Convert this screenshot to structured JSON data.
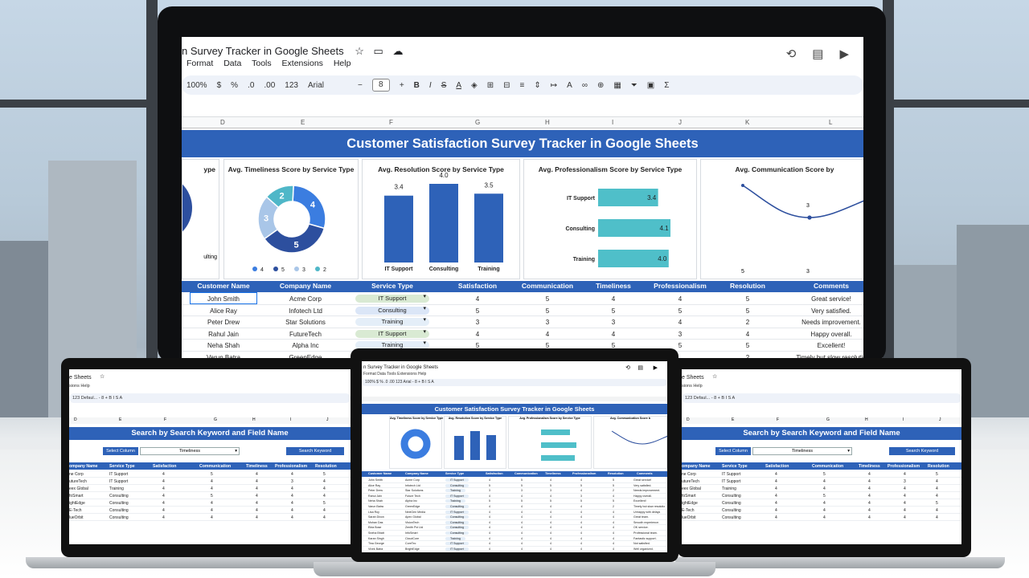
{
  "main": {
    "doc_title": "n Survey Tracker in Google Sheets",
    "menus": [
      "Format",
      "Data",
      "Tools",
      "Extensions",
      "Help"
    ],
    "toolbar": {
      "zoom": "100%",
      "currency": "$",
      "percent": "%",
      "dec_dec": ".0",
      "dec_inc": ".00",
      "num": "123",
      "font": "Arial",
      "font_size": "8"
    },
    "columns": [
      "D",
      "E",
      "F",
      "G",
      "H",
      "I",
      "J",
      "K",
      "L"
    ],
    "banner": "Customer Satisfaction Survey Tracker in Google Sheets",
    "charts": [
      {
        "title": "ype",
        "labels": [
          "ulting"
        ]
      },
      {
        "title": "Avg. Timeliness Score by Service Type",
        "type": "pie",
        "slices": [
          {
            "label": "4",
            "value": 4,
            "color": "#3b7de0"
          },
          {
            "label": "5",
            "value": 5,
            "color": "#2d4f9e"
          },
          {
            "label": "3",
            "value": 3,
            "color": "#a9c6e8"
          },
          {
            "label": "2",
            "value": 2,
            "color": "#4fb7c8"
          }
        ],
        "legend": [
          "4",
          "5",
          "3",
          "2"
        ]
      },
      {
        "title": "Avg. Resolution Score by Service Type",
        "type": "bar",
        "categories": [
          "IT Support",
          "Consulting",
          "Training"
        ],
        "values": [
          3.4,
          4.0,
          3.5
        ],
        "value_labels": [
          "3.4",
          "4.0",
          "3.5"
        ]
      },
      {
        "title": "Avg. Professionalism Score by Service Type",
        "type": "hbar",
        "categories": [
          "IT Support",
          "Consulting",
          "Training"
        ],
        "values": [
          3.4,
          4.1,
          4.0
        ],
        "value_labels": [
          "3.4",
          "4.1",
          "4.0"
        ]
      },
      {
        "title": "Avg. Communication Score by",
        "type": "line",
        "point_label": "3",
        "axis_labels": [
          "5",
          "3"
        ]
      }
    ],
    "table": {
      "headers": [
        "Customer Name",
        "Company Name",
        "Service Type",
        "Satisfaction",
        "Communication",
        "Timeliness",
        "Professionalism",
        "Resolution",
        "Comments"
      ],
      "rows": [
        {
          "name": "John Smith",
          "company": "Acme Corp",
          "service": "IT Support",
          "sat": "4",
          "comm": "5",
          "time": "4",
          "prof": "4",
          "res": "5",
          "comment": "Great service!"
        },
        {
          "name": "Alice Ray",
          "company": "Infotech Ltd",
          "service": "Consulting",
          "sat": "5",
          "comm": "5",
          "time": "5",
          "prof": "5",
          "res": "5",
          "comment": "Very satisfied."
        },
        {
          "name": "Peter Drew",
          "company": "Star Solutions",
          "service": "Training",
          "sat": "3",
          "comm": "3",
          "time": "3",
          "prof": "4",
          "res": "2",
          "comment": "Needs improvement."
        },
        {
          "name": "Rahul Jain",
          "company": "FutureTech",
          "service": "IT Support",
          "sat": "4",
          "comm": "4",
          "time": "4",
          "prof": "3",
          "res": "4",
          "comment": "Happy overall."
        },
        {
          "name": "Neha Shah",
          "company": "Alpha Inc",
          "service": "Training",
          "sat": "5",
          "comm": "5",
          "time": "5",
          "prof": "5",
          "res": "5",
          "comment": "Excellent!"
        },
        {
          "name": "Varun Batra",
          "company": "GreenEdge",
          "service": "",
          "sat": "",
          "comm": "",
          "time": "",
          "prof": "",
          "res": "2",
          "comment": "Timely but slow resolutio"
        }
      ],
      "service_colors": {
        "IT Support": "#d9ead3",
        "Consulting": "#dbe6f7",
        "Training": "#e4eef8"
      }
    }
  },
  "left_laptop": {
    "doc_title": "e Sheets",
    "menu": "sions   Help",
    "toolbar": "123   Defaul...   -   8   +   B   I   S   A",
    "columns": [
      "D",
      "E",
      "F",
      "G",
      "H",
      "I",
      "J"
    ],
    "banner": "Search by Search Keyword and Field Name",
    "select_label": "Select Column",
    "select_value": "Timeliness",
    "search_label": "Search Keyword",
    "headers": [
      "ompany Name",
      "Service Type",
      "Satisfaction",
      "Communication",
      "Timeliness",
      "Professionalism",
      "Resolution"
    ],
    "rows": [
      [
        "ne Corp",
        "IT Support",
        "4",
        "5",
        "4",
        "4",
        "5"
      ],
      [
        "utureTech",
        "IT Support",
        "4",
        "4",
        "4",
        "3",
        "4"
      ],
      [
        "eex Global",
        "Training",
        "4",
        "4",
        "4",
        "4",
        "4"
      ],
      [
        "foSmart",
        "Consulting",
        "4",
        "5",
        "4",
        "4",
        "4"
      ],
      [
        "ightEdge",
        "Consulting",
        "4",
        "4",
        "4",
        "4",
        "5"
      ],
      [
        "E-Tech",
        "Consulting",
        "4",
        "4",
        "4",
        "4",
        "4"
      ],
      [
        "lueOrbit",
        "Consulting",
        "4",
        "4",
        "4",
        "4",
        "4"
      ]
    ]
  },
  "center_laptop": {
    "doc_title": "n Survey Tracker in Google Sheets",
    "menu": "Format   Data   Tools   Extensions   Help",
    "toolbar": "100%   $   %   .0   .00   123   Arial   -   8   +   B   I   S   A",
    "banner": "Customer Satisfaction Survey Tracker in Google Sheets",
    "chart_titles": [
      "Avg. Timeliness Score by Service Type",
      "Avg. Resolution Score by Service Type",
      "Avg. Professionalism Score by Service Type",
      "Avg. Communication Score b"
    ],
    "headers": [
      "Customer Name",
      "Company Name",
      "Service Type",
      "Satisfaction",
      "Communication",
      "Timeliness",
      "Professionalism",
      "Resolution",
      "Comments"
    ],
    "rows": [
      [
        "John Smith",
        "Acme Corp",
        "IT Support",
        "4",
        "5",
        "4",
        "4",
        "5",
        "Great service!"
      ],
      [
        "Alice Ray",
        "Infotech Ltd",
        "Consulting",
        "5",
        "5",
        "5",
        "5",
        "5",
        "Very satisfied."
      ],
      [
        "Peter Drew",
        "Star Solutions",
        "Training",
        "3",
        "3",
        "3",
        "4",
        "2",
        "Needs improvement."
      ],
      [
        "Rahul Jain",
        "Future Tech",
        "IT Support",
        "4",
        "4",
        "4",
        "3",
        "4",
        "Happy overall."
      ],
      [
        "Neha Shah",
        "Alpha Inc",
        "Training",
        "5",
        "5",
        "5",
        "5",
        "5",
        "Excellent!"
      ],
      [
        "Varun Batra",
        "GreenEdge",
        "Consulting",
        "4",
        "4",
        "4",
        "4",
        "2",
        "Timely but slow resolutio"
      ],
      [
        "Lisa Roy",
        "NextGen Media",
        "IT Support",
        "4",
        "4",
        "4",
        "4",
        "4",
        "Unhappy with delays"
      ],
      [
        "Sarah Dixon",
        "Apex Global",
        "Consulting",
        "4",
        "4",
        "4",
        "4",
        "4",
        "Great team."
      ],
      [
        "Mohan Das",
        "VisionTech",
        "Consulting",
        "4",
        "4",
        "4",
        "4",
        "4",
        "Smooth experience."
      ],
      [
        "Ekta Bose",
        "Zenith Pvt Ltd",
        "Consulting",
        "4",
        "4",
        "4",
        "4",
        "4",
        "OK service."
      ],
      [
        "Sneha Bhatt",
        "InfoSmart",
        "Consulting",
        "4",
        "4",
        "4",
        "4",
        "4",
        "Professional team."
      ],
      [
        "Karan Singh",
        "CloudCore",
        "Training",
        "4",
        "4",
        "4",
        "4",
        "4",
        "Fantastic support."
      ],
      [
        "Tina George",
        "CoreTec",
        "IT Support",
        "4",
        "4",
        "4",
        "4",
        "4",
        "Not satisfied."
      ],
      [
        "Vivek Batra",
        "BrightEdge",
        "IT Support",
        "4",
        "4",
        "4",
        "4",
        "4",
        "Well organized."
      ]
    ]
  },
  "right_laptop": {
    "doc_title": "e Sheets",
    "menu": "sions   Help",
    "toolbar": "123   Defaul...   -   8   +   B   I   S   A",
    "columns": [
      "D",
      "E",
      "F",
      "G",
      "H",
      "I",
      "J"
    ],
    "banner": "Search by Search Keyword and Field Name",
    "select_label": "Select Column",
    "select_value": "Timeliness",
    "search_label": "Search Keyword",
    "headers": [
      "ompany Name",
      "Service Type",
      "Satisfaction",
      "Communication",
      "Timeliness",
      "Professionalism",
      "Resolution"
    ],
    "rows": [
      [
        "ne Corp",
        "IT Support",
        "4",
        "5",
        "4",
        "4",
        "5"
      ],
      [
        "utureTech",
        "IT Support",
        "4",
        "4",
        "4",
        "3",
        "4"
      ],
      [
        "eex Global",
        "Training",
        "4",
        "4",
        "4",
        "4",
        "4"
      ],
      [
        "foSmart",
        "Consulting",
        "4",
        "5",
        "4",
        "4",
        "4"
      ],
      [
        "ightEdge",
        "Consulting",
        "4",
        "4",
        "4",
        "4",
        "5"
      ],
      [
        "E-Tech",
        "Consulting",
        "4",
        "4",
        "4",
        "4",
        "4"
      ],
      [
        "lueOrbit",
        "Consulting",
        "4",
        "4",
        "4",
        "4",
        "4"
      ]
    ]
  }
}
